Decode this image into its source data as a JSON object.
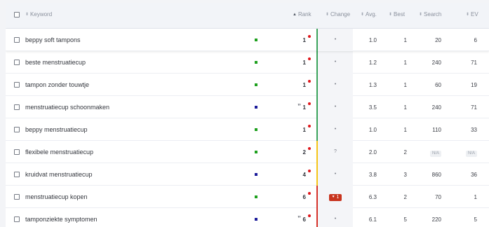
{
  "columns": {
    "keyword": "Keyword",
    "rank": "Rank",
    "change": "Change",
    "avg": "Avg.",
    "best": "Best",
    "search": "Search",
    "ev": "EV"
  },
  "colors": {
    "bar_green": "#3aa35b",
    "bar_yellow": "#f5c518",
    "bar_red": "#d6322a",
    "square_green": "#1ea01e",
    "square_blue": "#1c1c9a",
    "rank_dot": "#e0161b"
  },
  "rows": [
    {
      "keyword": "beppy soft tampons",
      "square": "green",
      "quote": false,
      "rank": "1",
      "change": "•",
      "avg": "1.0",
      "best": "1",
      "search": "20",
      "ev": "6",
      "bar": "green"
    },
    {
      "keyword": "beste menstruatiecup",
      "square": "green",
      "quote": false,
      "rank": "1",
      "change": "•",
      "avg": "1.2",
      "best": "1",
      "search": "240",
      "ev": "71",
      "bar": "green"
    },
    {
      "keyword": "tampon zonder touwtje",
      "square": "green",
      "quote": false,
      "rank": "1",
      "change": "•",
      "avg": "1.3",
      "best": "1",
      "search": "60",
      "ev": "19",
      "bar": "green"
    },
    {
      "keyword": "menstruatiecup schoonmaken",
      "square": "blue",
      "quote": true,
      "quote_icon": "quote-icon",
      "rank": "1",
      "change": "•",
      "avg": "3.5",
      "best": "1",
      "search": "240",
      "ev": "71",
      "bar": "green"
    },
    {
      "keyword": "beppy menstruatiecup",
      "square": "green",
      "quote": false,
      "rank": "1",
      "change": "•",
      "avg": "1.0",
      "best": "1",
      "search": "110",
      "ev": "33",
      "bar": "green"
    },
    {
      "keyword": "flexibele menstruatiecup",
      "square": "green",
      "quote": false,
      "rank": "2",
      "change": "?",
      "avg": "2.0",
      "best": "2",
      "search": "N/A",
      "ev": "N/A",
      "bar": "yellow"
    },
    {
      "keyword": "kruidvat menstruatiecup",
      "square": "blue",
      "quote": false,
      "rank": "4",
      "change": "•",
      "avg": "3.8",
      "best": "3",
      "search": "860",
      "ev": "36",
      "bar": "yellow"
    },
    {
      "keyword": "menstruatiecup kopen",
      "square": "green",
      "quote": false,
      "rank": "6",
      "change": "1",
      "change_down": true,
      "avg": "6.3",
      "best": "2",
      "search": "70",
      "ev": "1",
      "bar": "red"
    },
    {
      "keyword": "tamponziekte symptomen",
      "square": "blue",
      "quote": true,
      "quote_icon": "quote-icon",
      "rank": "6",
      "change": "•",
      "avg": "6.1",
      "best": "5",
      "search": "220",
      "ev": "5",
      "bar": "red"
    }
  ]
}
